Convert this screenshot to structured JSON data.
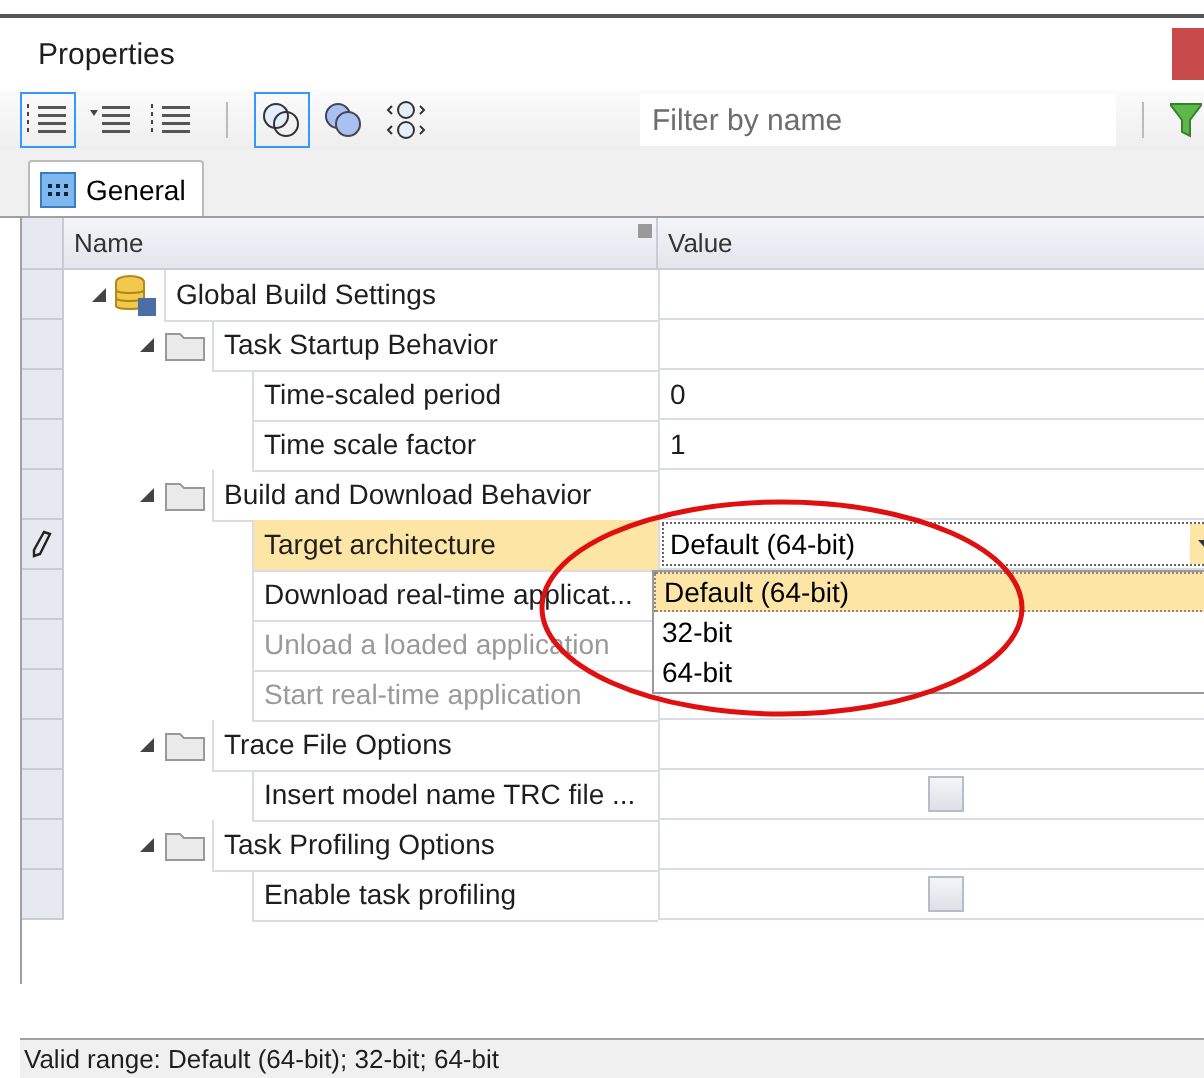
{
  "window": {
    "title": "Properties"
  },
  "toolbar": {
    "buttons": [
      {
        "kind": "categorized",
        "selected": true
      },
      {
        "kind": "alphabetical",
        "selected": false
      },
      {
        "kind": "list",
        "selected": false
      },
      {
        "kind": "separator"
      },
      {
        "kind": "circles-outline",
        "selected": true
      },
      {
        "kind": "circles-filled",
        "selected": false
      },
      {
        "kind": "circles-split",
        "selected": false
      }
    ],
    "filter": {
      "placeholder": "Filter by name"
    }
  },
  "tabs": [
    {
      "label": "General",
      "selected": true
    }
  ],
  "grid": {
    "columns": [
      "Name",
      "Value"
    ],
    "rows": [
      {
        "name": "Global Build Settings",
        "kind": "root",
        "expanded": true,
        "children": [
          {
            "name": "Task Startup Behavior",
            "kind": "group",
            "expanded": true,
            "children": [
              {
                "name": "Time-scaled period",
                "kind": "text",
                "value": "0",
                "disabled": false,
                "selected": false
              },
              {
                "name": "Time scale factor",
                "kind": "text",
                "value": "1",
                "disabled": false,
                "selected": false
              }
            ]
          },
          {
            "name": "Build and Download Behavior",
            "kind": "group",
            "expanded": true,
            "children": [
              {
                "name": "Target architecture",
                "kind": "combo",
                "value": "Default (64-bit)",
                "disabled": false,
                "selected": true,
                "options": [
                  {
                    "label": "Default (64-bit)",
                    "selected": true
                  },
                  {
                    "label": "32-bit",
                    "selected": false
                  },
                  {
                    "label": "64-bit",
                    "selected": false
                  }
                ]
              },
              {
                "name": "Download real-time applicat...",
                "kind": "hidden",
                "disabled": false,
                "selected": false
              },
              {
                "name": "Unload a loaded application",
                "kind": "hidden",
                "disabled": true,
                "selected": false
              },
              {
                "name": "Start real-time application",
                "kind": "hidden",
                "disabled": true,
                "selected": false
              }
            ]
          },
          {
            "name": "Trace File Options",
            "kind": "group",
            "expanded": true,
            "children": [
              {
                "name": "Insert model name TRC file ...",
                "kind": "checkbox",
                "checked": false,
                "disabled": false,
                "selected": false
              }
            ]
          },
          {
            "name": "Task Profiling Options",
            "kind": "group",
            "expanded": true,
            "children": [
              {
                "name": "Enable task profiling",
                "kind": "checkbox",
                "checked": false,
                "disabled": false,
                "selected": false
              }
            ]
          }
        ]
      }
    ]
  },
  "status_bar": "Valid range: Default (64-bit); 32-bit; 64-bit"
}
